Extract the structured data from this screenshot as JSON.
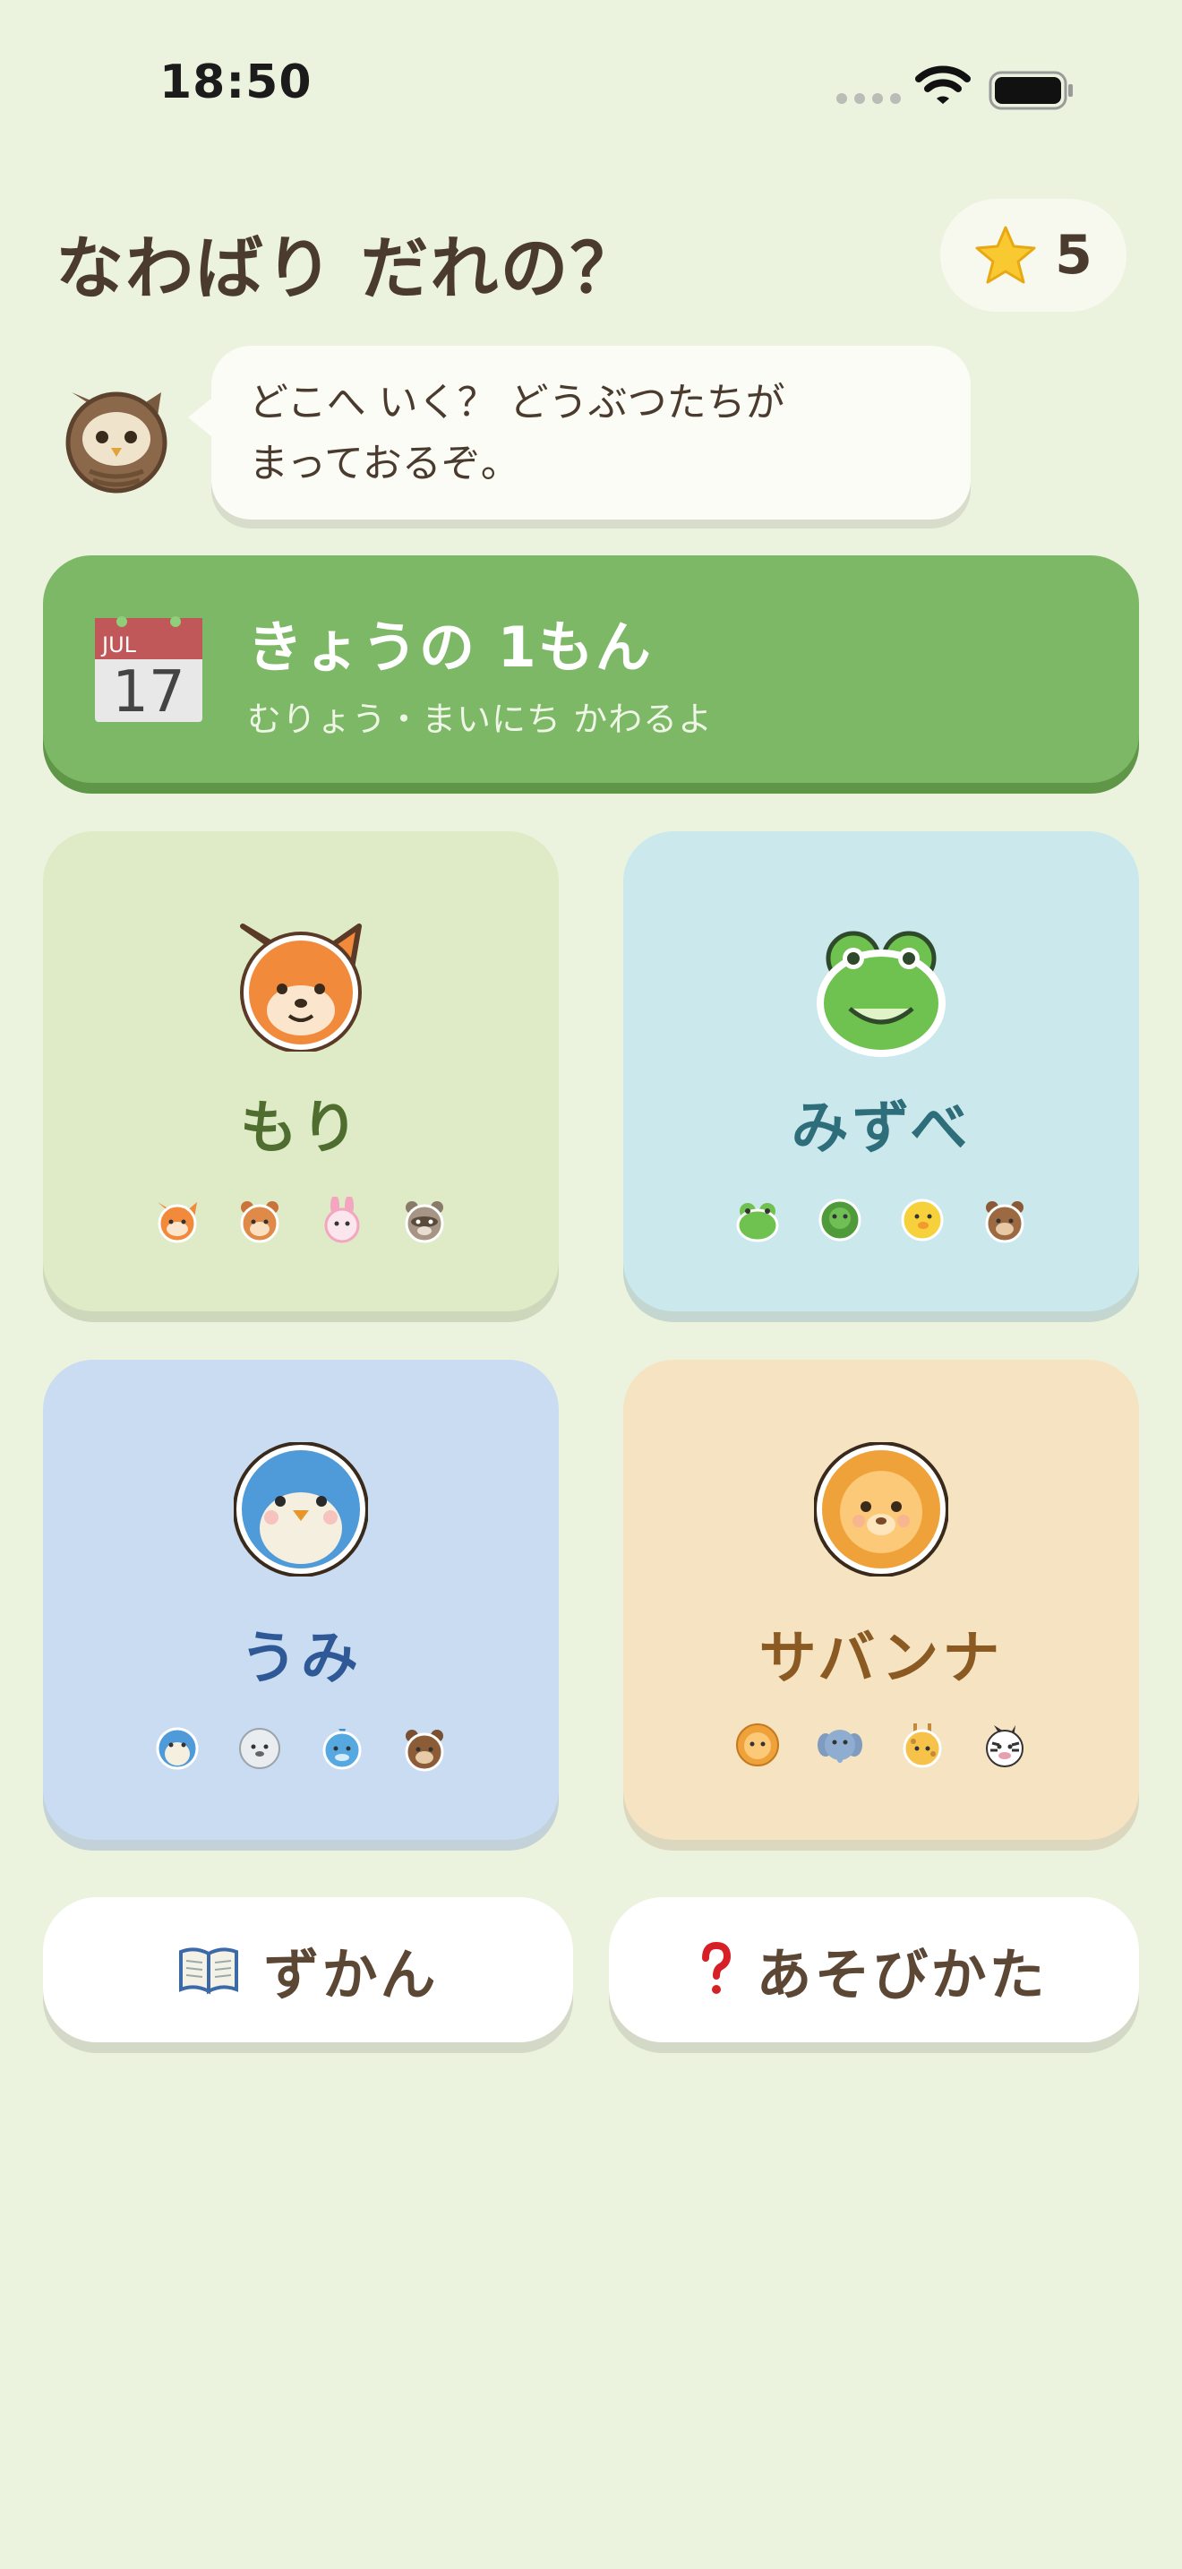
{
  "status_bar": {
    "time": "18:50"
  },
  "header": {
    "title": "なわばり だれの？",
    "stars": "5"
  },
  "owl_message": "どこへ いく？ どうぶつたちが\nまっておるぞ。",
  "daily": {
    "title": "きょうの 1もん",
    "subtitle": "むりょう・まいにち かわるよ",
    "calendar_month": "JUL",
    "calendar_day": "17"
  },
  "areas": [
    {
      "label": "もり",
      "icon": "fox-icon",
      "color": "#4e6d2e",
      "animals": [
        "fox-icon",
        "squirrel-icon",
        "rabbit-icon",
        "raccoon-icon"
      ]
    },
    {
      "label": "みずべ",
      "icon": "frog-icon",
      "color": "#2e6e7a",
      "animals": [
        "frog-icon",
        "turtle-icon",
        "duck-icon",
        "bear-icon"
      ]
    },
    {
      "label": "うみ",
      "icon": "penguin-icon",
      "color": "#2f5996",
      "animals": [
        "penguin-icon",
        "seal-icon",
        "dolphin-icon",
        "otter-icon"
      ]
    },
    {
      "label": "サバンナ",
      "icon": "lion-icon",
      "color": "#8a5a22",
      "animals": [
        "lion-icon",
        "elephant-icon",
        "giraffe-icon",
        "zebra-icon"
      ]
    }
  ],
  "buttons": {
    "zukan": "ずかん",
    "howto": "あそびかた"
  }
}
